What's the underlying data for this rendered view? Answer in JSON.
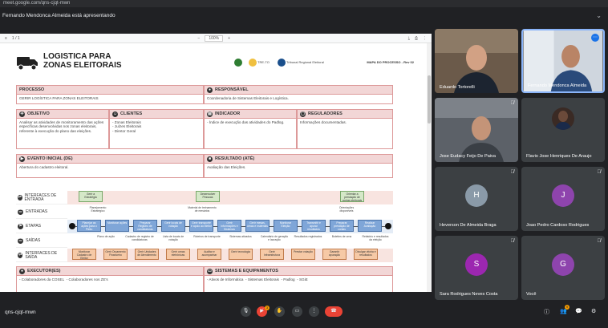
{
  "browser": {
    "tab_text": "meet.google.com/qns-cjqt-mwn"
  },
  "banner": {
    "presenter": "Fernando Mendonca Almeida está apresentando"
  },
  "doc": {
    "toolbar": {
      "zoom": "100%"
    },
    "title": "LOGISTICA PARA\nZONAS ELEITORAIS",
    "org_logos": [
      "TRE-TO",
      "Tribunal Regional Eleitoral"
    ],
    "map_label": "MAPA DO PROCESSO - Rev 02",
    "sections": {
      "processo": {
        "label": "PROCESSO",
        "text": "GERIR LOGÍSTICA PARA ZONAS ELEITORAIS"
      },
      "responsavel": {
        "label": "RESPONSÁVEL",
        "text": "Coordenadoria de Sistemas Eleitorais e Logística."
      },
      "objetivo": {
        "label": "OBJETIVO",
        "text": "Analisar as atividades de monitoramento das ações específicas desenvolvidas nos zonas eleitorais, referente à execução do plano das eleições."
      },
      "clientes": {
        "label": "CLIENTES",
        "items": [
          "- Zonas Eleitorais",
          "- Juízes Eleitorais",
          "- Diretor Geral"
        ]
      },
      "indicador": {
        "label": "INDICADOR",
        "text": "- Índice de execução das atividades do Padlog."
      },
      "reguladores": {
        "label": "REGULADORES",
        "text": "Informações documentadas."
      },
      "evento": {
        "label": "EVENTO INICIAL (DE)",
        "text": "Abertura do cadastro eleitoral."
      },
      "resultado": {
        "label": "RESULTADO (ATÉ)",
        "text": "Avaliação das Eleições."
      },
      "executores": {
        "label": "EXECUTOR(ES)",
        "items": [
          "- Colaboradores da COSEL",
          "- Colaboradores nos ZE's"
        ]
      },
      "sistemas": {
        "label": "SISTEMAS E EQUIPAMENTOS",
        "items": [
          "- Ativos de Informática",
          "- Sistemas Eleitorais",
          "- Padlog",
          "- SGiE"
        ]
      }
    },
    "lanes": [
      {
        "label": "INTERFACES DE ENTRADA",
        "style": "pink"
      },
      {
        "label": "ENTRADAS",
        "style": "white"
      },
      {
        "label": "ETAPAS",
        "style": "blue"
      },
      {
        "label": "SAÍDAS",
        "style": "white"
      },
      {
        "label": "INTERFACES DE SAÍDA",
        "style": "pink"
      }
    ],
    "entrada_interfaces": [
      "Gerir a Estratégia",
      "Desenvolver Pessoas",
      "Orientar a prestação de contas eleitorais"
    ],
    "entradas": [
      "Planejamento Estratégico",
      "Material de treinamento de mesários",
      "Orientações disponíveis"
    ],
    "etapas": [
      "Planejar as ações para o Pleito",
      "Monitorar ações",
      "Preparar Registro de candidaturas",
      "Gerir locais de votação",
      "Gerir transporte e apoio ao eleitor",
      "Gerir informações e Sistemas",
      "Gerir mesas, urnas e materiais",
      "Monitorar Eleição",
      "Transmitir e apurar resultados",
      "Preparar prestação de contas",
      "Realizar Avaliação"
    ],
    "saidas": [
      "Plano de ação",
      "Cadastro de registro de candidaturas",
      "Lista de locais de votação",
      "Roteiros de transporte",
      "Sistemas ativados",
      "Calendário de geração e lacração",
      "Resultados registrados",
      "Boletins de urna",
      "Relatório e resultados da eleição"
    ],
    "saida_interfaces": [
      "Monitorar Cadastro de Eleitor",
      "Gerir Orçamento Financeiro",
      "Gerir Unidades de Atendimento",
      "Gerir urnas eletrônicas",
      "Auditar e acompanhar",
      "Gerir tecnologia",
      "Gerir Infraestrutura",
      "Prestar votação",
      "Garantir apuração",
      "Divulgar vitória e resultados"
    ]
  },
  "participants": [
    {
      "name": "Eduardo Tortorelli",
      "type": "video"
    },
    {
      "name": "Fernando Mendonca Almeida",
      "type": "video",
      "active": true
    },
    {
      "name": "Jose Eudacy Feijo De Paiva",
      "type": "video"
    },
    {
      "name": "Flavio Jose Henriques De Araujo",
      "type": "photo"
    },
    {
      "name": "Heverson De Almeida Braga",
      "initial": "H",
      "color": "#8a9aa8"
    },
    {
      "name": "Joao Pedro Cardoso Rodrigues",
      "initial": "J",
      "color": "#8e44ad"
    },
    {
      "name": "Sara Rodrigues Neves Costa",
      "initial": "S",
      "color": "#9c27b0"
    },
    {
      "name": "Você",
      "initial": "G",
      "color": "#8e44ad"
    }
  ],
  "bottom": {
    "meeting_code": "qns-cjqt-mwn",
    "people_count": "9",
    "raise_count": "3"
  },
  "colors": {
    "end_call": "#ea4335",
    "active_border": "#8ab4f8"
  }
}
